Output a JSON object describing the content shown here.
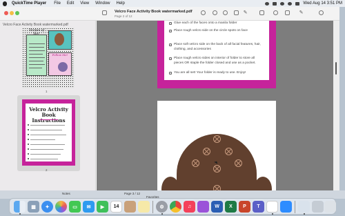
{
  "menubar": {
    "app_name": "QuickTime Player",
    "items": [
      "File",
      "Edit",
      "View",
      "Window",
      "Help"
    ],
    "clock": "Wed Aug 14  3:51 PM"
  },
  "window": {
    "title": "Velcro Face Activity Book watermarked.pdf",
    "subtitle": "Page 2 of 12"
  },
  "sidebar": {
    "label": "Velcro Face Activity Book watermarked.pdf",
    "page1_label": "1",
    "page2_label": "2",
    "thumb1_title": "Stories of Her",
    "thumb1_pink_title": "Follow Me!",
    "thumb2_title": "Velcro Activity Book Instructions"
  },
  "document": {
    "checklist": [
      "Glue each of the faces onto a manila folder",
      "Place rough velcro side on the circle spots on face",
      "Place soft velcro side on the back of all facial features, hair, clothing, and accessories",
      "Place rough velcro sides on interior of folder to store all pieces OR staple the folder closed and use as a pocket.",
      "You are all set! Your folder is ready to use. Enjoy!"
    ]
  },
  "backdrop": {
    "left_label": "Notes",
    "center_label": "Page 3 / 12",
    "favorites": "Favorites"
  },
  "dock": {
    "calendar_day": "14",
    "apps": [
      "finder",
      "launchpad",
      "safari",
      "photos",
      "messages",
      "facetime",
      "calendar",
      "contacts",
      "notes",
      "system-settings",
      "chrome",
      "music",
      "podcasts",
      "word",
      "excel",
      "powerpoint",
      "teams",
      "zoom",
      "preview",
      "downloads",
      "trash"
    ]
  }
}
